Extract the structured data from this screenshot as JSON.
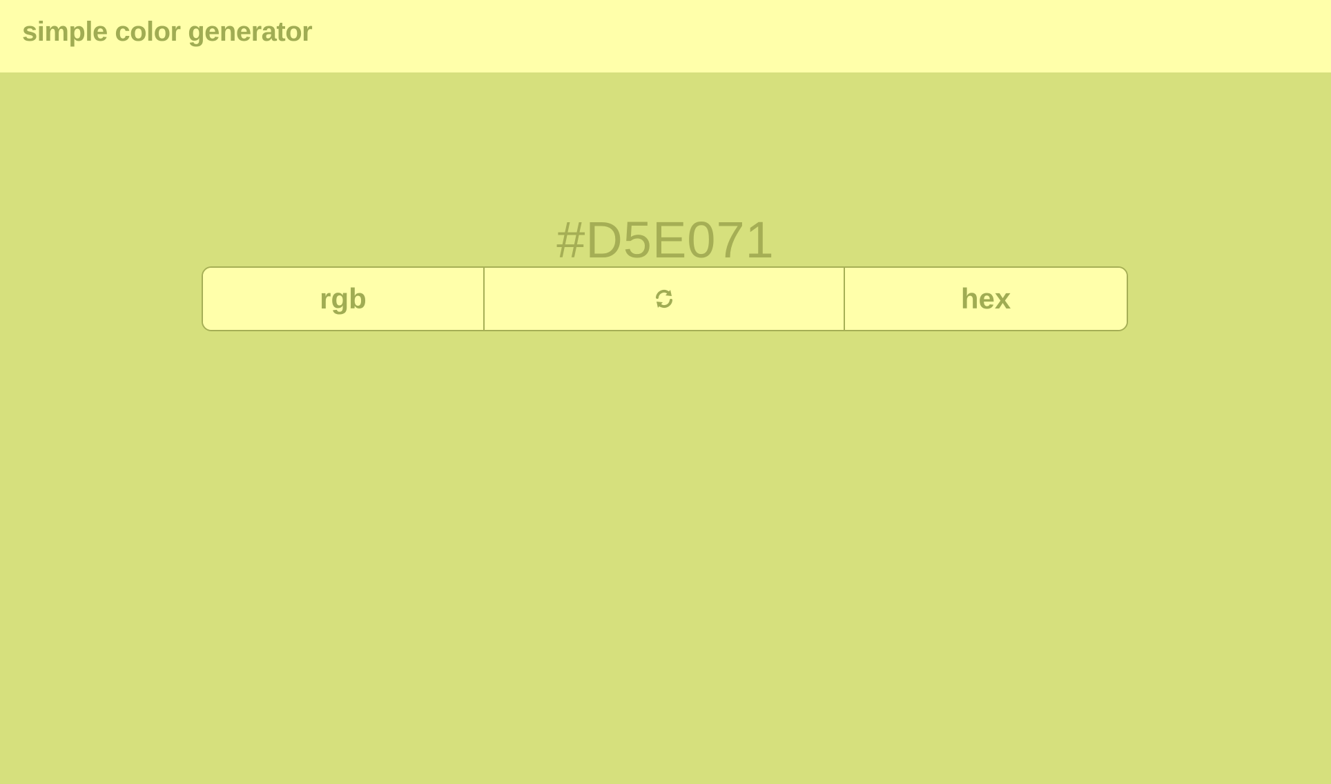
{
  "header": {
    "title": "simple color generator",
    "background": "#FFFFAA"
  },
  "main": {
    "color_code": "#D5E071",
    "background": "#D5E071",
    "accent": "#A5AE55"
  },
  "buttons": {
    "rgb_label": "rgb",
    "refresh_icon": "refresh-icon",
    "hex_label": "hex"
  }
}
